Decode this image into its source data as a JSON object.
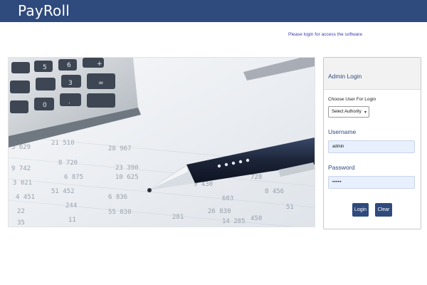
{
  "header": {
    "brand": "PayRoll"
  },
  "notice": "Please login for access the software",
  "hero": {
    "alt_icon": "calculator-pen-financial-photo"
  },
  "login": {
    "title": "Admin Login",
    "choose_user_label": "Choose User For Login",
    "choose_user_selected": "Select Authority",
    "username_label": "Username",
    "username_value": "admin",
    "password_label": "Password",
    "password_value": "•••••",
    "login_button": "Login",
    "clear_button": "Clear"
  },
  "colors": {
    "navbar": "#2f4a7d",
    "accent_text": "#2f4a7d",
    "notice_text": "#3b3bb3",
    "input_bg": "#e8f0fe"
  }
}
